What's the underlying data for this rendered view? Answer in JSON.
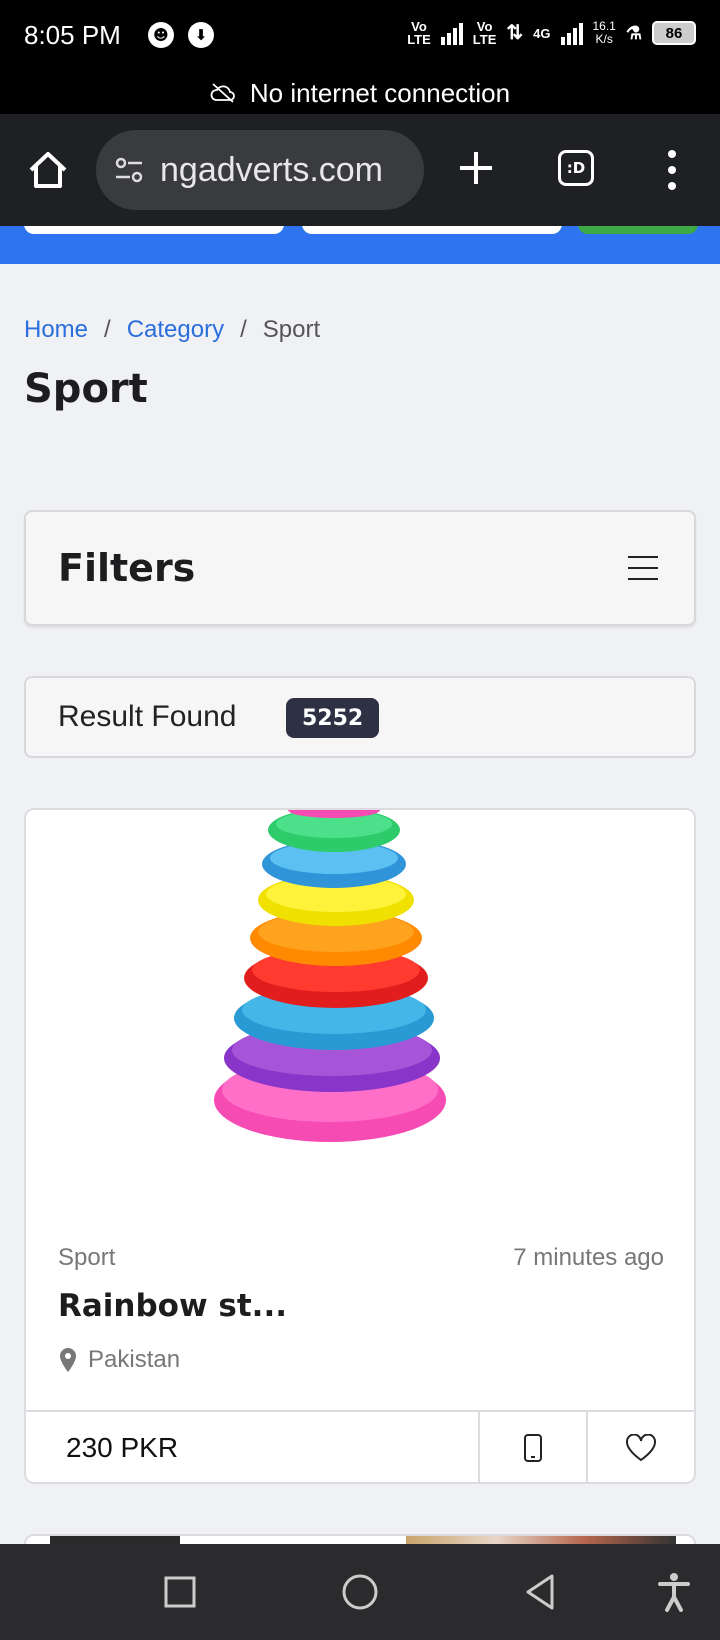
{
  "status_bar": {
    "time": "8:05 PM",
    "sim1": "Vo\nLTE",
    "sim2": "Vo\nLTE",
    "network": "4G",
    "speed_value": "16.1",
    "speed_unit": "K/s",
    "battery": "86"
  },
  "offline_banner": {
    "text": "No internet connection",
    "icon": "cloud-off-icon"
  },
  "browser": {
    "url": "ngadverts.com",
    "tab_switcher_label": ":D"
  },
  "breadcrumb": {
    "home": "Home",
    "separator": "/",
    "category": "Category",
    "current": "Sport"
  },
  "page": {
    "title": "Sport"
  },
  "filters": {
    "title": "Filters"
  },
  "results": {
    "label": "Result Found",
    "count": "5252"
  },
  "product": {
    "category": "Sport",
    "time_ago": "7 minutes ago",
    "title": "Rainbow st...",
    "location": "Pakistan",
    "price": "230 PKR"
  },
  "colors": {
    "accent": "#2e74f0",
    "link": "#2a6fdb",
    "badge": "#2e3044"
  }
}
